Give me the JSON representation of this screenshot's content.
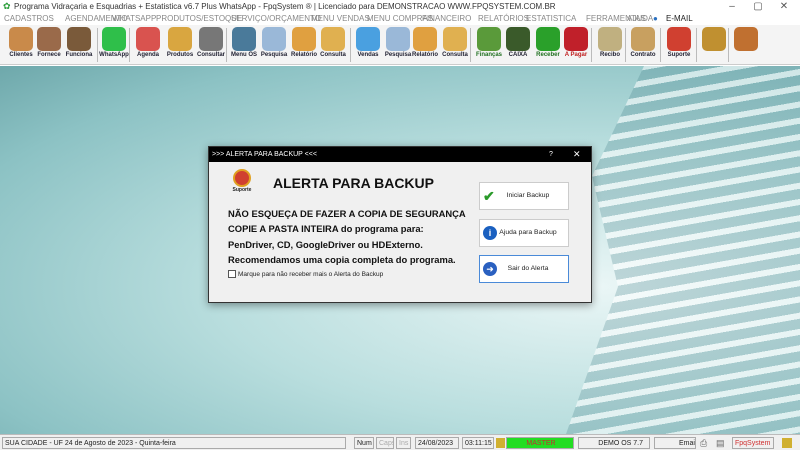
{
  "window": {
    "title": "Programa Vidraçaria e Esquadrias + Estatistica v6.7 Plus WhatsApp - FpqSystem ® | Licenciado para  DEMONSTRACAO WWW.FPQSYSTEM.COM.BR",
    "minimize": "–",
    "maximize": "▢",
    "close": "✕"
  },
  "menu": [
    "CADASTROS",
    "AGENDAMENTO",
    "WHATSAPP",
    "PRODUTOS/ESTOQUE",
    "SERVIÇO/ORÇAMENTO",
    "MENU VENDAS",
    "MENU COMPRAS",
    "FINANCEIRO",
    "RELATÓRIOS",
    "ESTATISTICA",
    "FERRAMENTAS",
    "AJUDA",
    "E-MAIL"
  ],
  "toolbar": [
    {
      "label": "Clientes",
      "icon": "clients-icon",
      "color": "#c98a4a"
    },
    {
      "label": "Fornece",
      "icon": "supplier-icon",
      "color": "#9a6a4a"
    },
    {
      "label": "Funciona",
      "icon": "employee-icon",
      "color": "#7a5a3a"
    },
    {
      "label": "WhatsApp",
      "icon": "whatsapp-icon",
      "color": "#2fbf4a"
    },
    {
      "label": "Agenda",
      "icon": "calendar-icon",
      "color": "#d9534f"
    },
    {
      "label": "Produtos",
      "icon": "boxes-icon",
      "color": "#d9a640"
    },
    {
      "label": "Consultar",
      "icon": "barcode-icon",
      "color": "#777"
    },
    {
      "label": "Menu OS",
      "icon": "clipboard-icon",
      "color": "#4a7a9a"
    },
    {
      "label": "Pesquisa",
      "icon": "search-doc-icon",
      "color": "#9ab8d8"
    },
    {
      "label": "Relatório",
      "icon": "report-icon",
      "color": "#e0a040"
    },
    {
      "label": "Consulta",
      "icon": "folder-icon",
      "color": "#e0b050"
    },
    {
      "label": "Vendas",
      "icon": "monitor-icon",
      "color": "#4aa0e0"
    },
    {
      "label": "Pesquisa",
      "icon": "search-doc-icon",
      "color": "#9ab8d8"
    },
    {
      "label": "Relatório",
      "icon": "report-icon",
      "color": "#e0a040"
    },
    {
      "label": "Consulta",
      "icon": "folder-icon",
      "color": "#e0b050"
    },
    {
      "label": "Finanças",
      "icon": "finance-icon",
      "color": "#5a9a3a"
    },
    {
      "label": "CAIXA",
      "icon": "cashbook-icon",
      "color": "#3a5a2a"
    },
    {
      "label": "Receber",
      "icon": "dollar-green-icon",
      "color": "#2aa02a"
    },
    {
      "label": "A Pagar",
      "icon": "dollar-red-icon",
      "color": "#c0202a"
    },
    {
      "label": "Recibo",
      "icon": "receipt-icon",
      "color": "#c0b080"
    },
    {
      "label": "Contrato",
      "icon": "scroll-icon",
      "color": "#c8a060"
    },
    {
      "label": "Suporte",
      "icon": "support-icon",
      "color": "#d04030"
    },
    {
      "label": "",
      "icon": "coins-icon",
      "color": "#c09030"
    },
    {
      "label": "",
      "icon": "exit-icon",
      "color": "#c07030"
    }
  ],
  "dialog": {
    "title": ">>> ALERTA PARA BACKUP <<<",
    "help": "?",
    "close": "✕",
    "heading": "ALERTA PARA BACKUP",
    "support_logo_text": "Suporte",
    "lines": [
      "NÃO ESQUEÇA DE FAZER A COPIA DE SEGURANÇA",
      "COPIE A PASTA INTEIRA do programa para:",
      "PenDriver, CD, GoogleDriver ou HDExterno.",
      "Recomendamos uma copia completa do programa."
    ],
    "checkbox_label": "Marque para não receber mais o Alerta do Backup",
    "checkbox_checked": false,
    "buttons": [
      "Iniciar Backup",
      "Ajuda para Backup",
      "Sair do Alerta"
    ]
  },
  "status": {
    "city": "SUA CIDADE - UF 24 de Agosto de 2023 - Quinta-feira",
    "num": "Num",
    "caps": "Caps",
    "ins": "Ins",
    "date": "24/08/2023",
    "time": "03:11:15",
    "user": "MASTER",
    "version": "DEMO OS 7.7",
    "email": "Email",
    "brand": "FpqSystem"
  }
}
